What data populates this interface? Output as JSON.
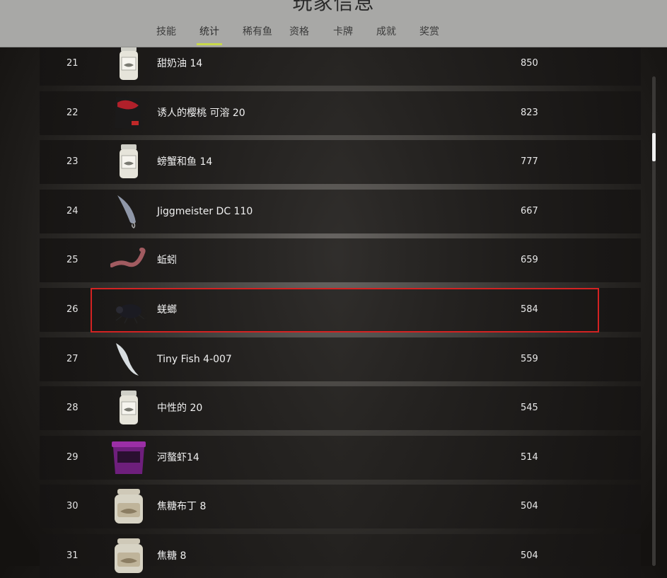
{
  "header": {
    "title": "玩家信息",
    "tabs": [
      {
        "label": "技能",
        "active": false
      },
      {
        "label": "统计",
        "active": true
      },
      {
        "label": "稀有鱼",
        "active": false
      },
      {
        "label": "资格",
        "active": false
      },
      {
        "label": "卡牌",
        "active": false
      },
      {
        "label": "成就",
        "active": false
      },
      {
        "label": "奖赏",
        "active": false
      }
    ],
    "accent_color": "#c8d84a"
  },
  "rows": [
    {
      "rank": "21",
      "name": "甜奶油 14",
      "value": "850",
      "icon": "jar-icon"
    },
    {
      "rank": "22",
      "name": "诱人的樱桃 可溶 20",
      "value": "823",
      "icon": "bag-icon"
    },
    {
      "rank": "23",
      "name": "螃蟹和鱼 14",
      "value": "777",
      "icon": "jar-icon"
    },
    {
      "rank": "24",
      "name": "Jiggmeister DC 110",
      "value": "667",
      "icon": "spoon-lure-icon"
    },
    {
      "rank": "25",
      "name": "蚯蚓",
      "value": "659",
      "icon": "worm-icon"
    },
    {
      "rank": "26",
      "name": "蜣螂",
      "value": "584",
      "icon": "beetle-icon",
      "highlighted": true
    },
    {
      "rank": "27",
      "name": "Tiny Fish 4-007",
      "value": "559",
      "icon": "soft-bait-icon"
    },
    {
      "rank": "28",
      "name": "中性的 20",
      "value": "545",
      "icon": "jar-icon"
    },
    {
      "rank": "29",
      "name": "河螯虾14",
      "value": "514",
      "icon": "bucket-icon"
    },
    {
      "rank": "30",
      "name": "焦糖布丁 8",
      "value": "504",
      "icon": "cork-jar-icon"
    },
    {
      "rank": "31",
      "name": "焦糖 8",
      "value": "504",
      "icon": "cork-jar-icon"
    }
  ],
  "highlight_color": "#d32222"
}
